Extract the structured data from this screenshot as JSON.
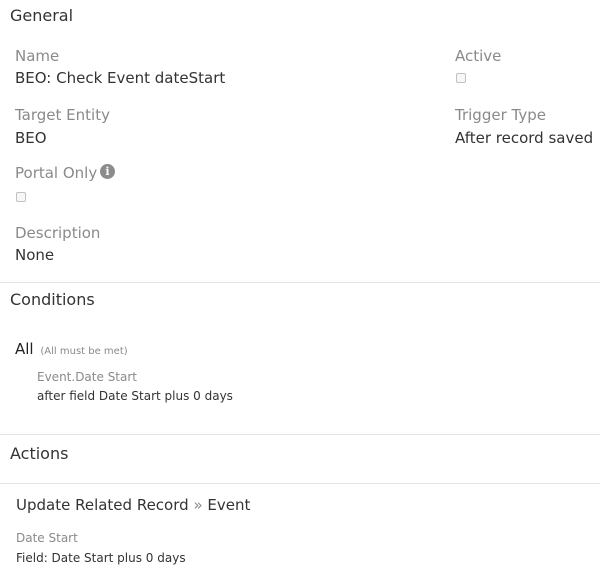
{
  "general": {
    "title": "General",
    "name_label": "Name",
    "name_value": "BEO: Check Event dateStart",
    "active_label": "Active",
    "target_entity_label": "Target Entity",
    "target_entity_value": "BEO",
    "trigger_type_label": "Trigger Type",
    "trigger_type_value": "After record saved",
    "portal_only_label": "Portal Only",
    "description_label": "Description",
    "description_value": "None"
  },
  "conditions": {
    "title": "Conditions",
    "group_label": "All",
    "group_hint": "(All must be met)",
    "field_label": "Event.Date Start",
    "field_value": "after field Date Start plus 0 days"
  },
  "actions": {
    "title": "Actions",
    "action_type": "Update Related Record",
    "separator": "»",
    "action_target": "Event",
    "field_label": "Date Start",
    "field_value": "Field: Date Start plus 0 days"
  },
  "icons": {
    "info": "info-circle-icon"
  },
  "colors": {
    "label": "#8a8a8a",
    "text": "#333333",
    "divider": "#e4e4e4"
  }
}
